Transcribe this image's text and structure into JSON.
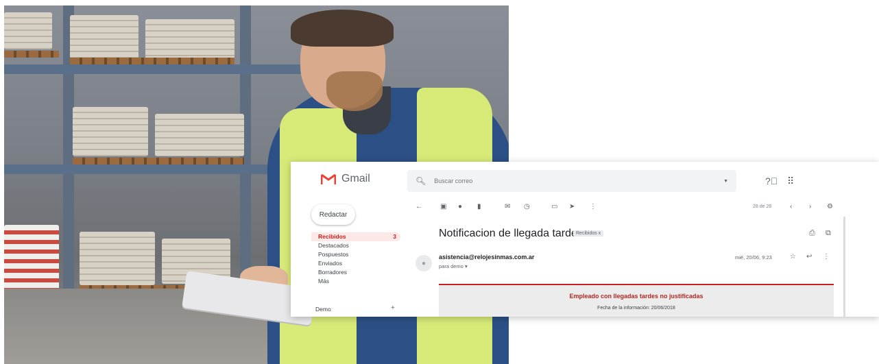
{
  "gmail": {
    "logo_text": "Gmail",
    "search_placeholder": "Buscar correo",
    "compose_label": "Redactar",
    "nav_items": [
      {
        "label": "Recibidos",
        "count": "3"
      },
      {
        "label": "Destacados",
        "count": ""
      },
      {
        "label": "Pospuestos",
        "count": ""
      },
      {
        "label": "Enviados",
        "count": ""
      },
      {
        "label": "Borradores",
        "count": ""
      },
      {
        "label": "Más",
        "count": ""
      }
    ],
    "user_label": "Demo",
    "pager": "28 de 28",
    "subject": "Notificacion de llegada tarde",
    "label_chip": "Recibidos x",
    "sender": "asistencia@relojesinmas.com.ar",
    "recipient": "para demo ▾",
    "date": "mié, 20/06, 9:23",
    "body_title": "Empleado con llegadas tardes no justificadas",
    "body_date": "Fecha de la información: 20/06/2018",
    "brand_red": "#EA4335"
  }
}
